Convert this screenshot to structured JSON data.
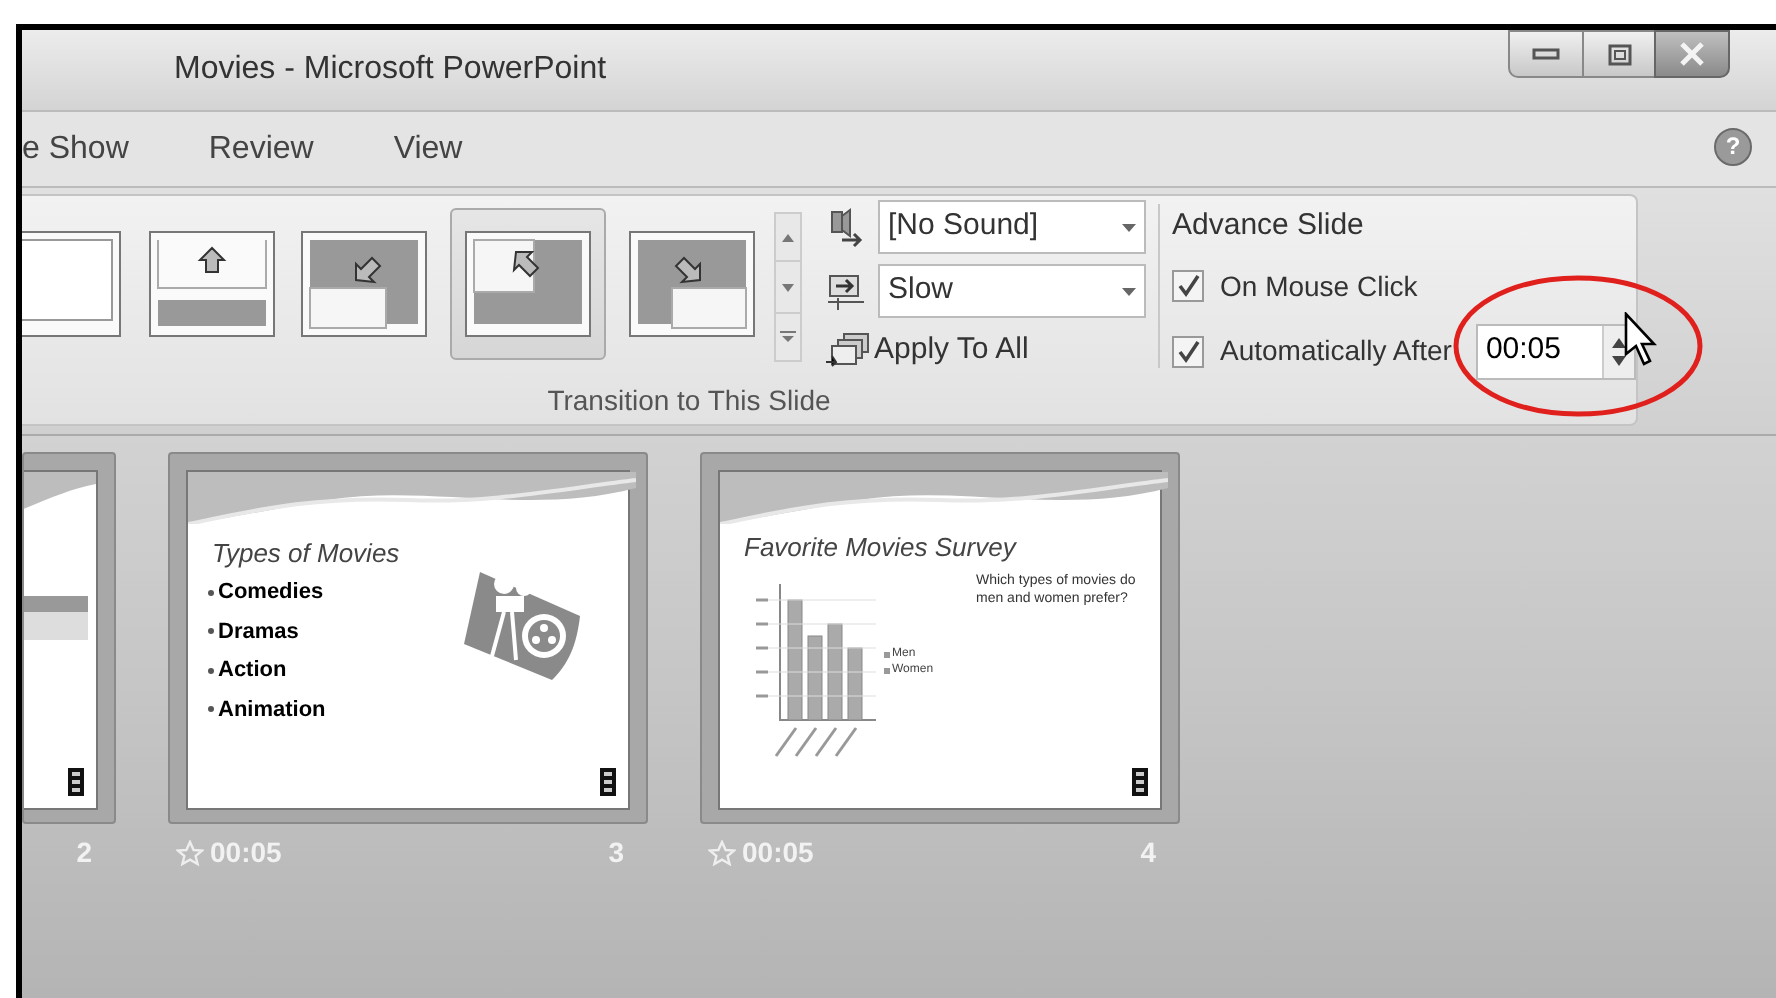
{
  "window": {
    "title": "Movies - Microsoft PowerPoint"
  },
  "help_button": "?",
  "tabs": [
    {
      "label": "e Show",
      "selected": false
    },
    {
      "label": "Review",
      "selected": false
    },
    {
      "label": "View",
      "selected": false
    }
  ],
  "ribbon": {
    "gallery": [
      {
        "kind": "edge",
        "selected": false
      },
      {
        "kind": "up",
        "selected": false
      },
      {
        "kind": "down-left",
        "selected": false
      },
      {
        "kind": "up-left",
        "selected": true
      },
      {
        "kind": "down-right",
        "selected": false
      }
    ],
    "sound": {
      "value": "[No Sound]"
    },
    "speed": {
      "value": "Slow"
    },
    "apply_button": "Apply To All",
    "group_label": "Transition to This Slide",
    "advance": {
      "title": "Advance Slide",
      "on_mouse_click": {
        "label": "On Mouse Click",
        "checked": true
      },
      "automatically_after": {
        "label": "Automatically After",
        "checked": true,
        "value": "00:05",
        "callout_ellipse": true,
        "pointer_cursor": true
      }
    }
  },
  "slides": [
    {
      "kind": "partial",
      "number": "2"
    },
    {
      "kind": "bullets",
      "number": "3",
      "time": "00:05",
      "title": "Types of Movies",
      "bullets": [
        "Comedies",
        "Dramas",
        "Action",
        "Animation"
      ]
    },
    {
      "kind": "chart",
      "number": "4",
      "time": "00:05",
      "title": "Favorite Movies Survey",
      "text": "Which types of movies do men and women prefer?",
      "legend": [
        "Men",
        "Women"
      ]
    }
  ]
}
